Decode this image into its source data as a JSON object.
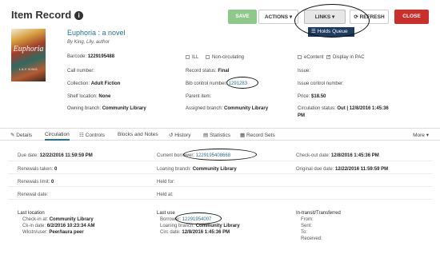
{
  "header": {
    "title": "Item Record",
    "info_glyph": "i",
    "save_label": "SAVE",
    "actions_label": "ACTIONS ▾",
    "links_label": "LINKS ▾",
    "refresh_label": "REFRESH",
    "close_label": "CLOSE",
    "links_menu_item": "Holds Queue",
    "colors": {
      "save": "#8cc98a",
      "close": "#c9302c",
      "link": "#27718f"
    }
  },
  "book": {
    "cover_author": "LILY KING",
    "cover_title": "Euphoria",
    "title": "Euphoria : a novel",
    "author": "By King, Lily, author"
  },
  "details": {
    "barcode_label": "Barcode:",
    "barcode_value": "1229195488",
    "call_number_label": "Call number:",
    "collection_label": "Collection:",
    "collection_value": "Adult Fiction",
    "shelf_label": "Shelf location:",
    "shelf_value": "None",
    "owning_label": "Owning branch:",
    "owning_value": "Community Library",
    "ill_label": "ILL",
    "noncirc_label": "Non-circulating",
    "record_status_label": "Record status:",
    "record_status_value": "Final",
    "bib_label": "Bib control number:",
    "bib_value": "1291283",
    "parent_label": "Parent item:",
    "assigned_label": "Assigned branch:",
    "assigned_value": "Community Library",
    "econtent_label": "eContent",
    "pac_label": "Display in PAC",
    "issue_label": "Issue:",
    "issue_control_label": "Issue control number:",
    "price_label": "Price:",
    "price_value": "$18.50",
    "circ_status_label": "Circulation status:",
    "circ_status_value": "Out | 12/8/2016 1:45:36",
    "circ_status_value2": "PM"
  },
  "tabs": {
    "details": "Details",
    "circulation": "Circulation",
    "controls": "Controls",
    "blocks": "Blocks and Notes",
    "history": "History",
    "statistics": "Statistics",
    "record_sets": "Record Sets",
    "more": "More ▾"
  },
  "circ": {
    "due_date_label": "Due date:",
    "due_date_value": "12/22/2016 11:59:59 PM",
    "renewals_taken_label": "Renewals taken:",
    "renewals_taken_value": "0",
    "renewals_limit_label": "Renewals limit:",
    "renewals_limit_value": "0",
    "renewal_date_label": "Renewal date:",
    "current_borrower_label": "Current borrower:",
    "current_borrower_value": "1229195408668",
    "loaning_label": "Loaning branch:",
    "loaning_value": "Community Library",
    "held_for_label": "Held for:",
    "held_at_label": "Held at:",
    "checkout_label": "Check-out date:",
    "checkout_value": "12/8/2016 1:45:36 PM",
    "original_due_label": "Original due date:",
    "original_due_value": "12/22/2016 11:59:59 PM"
  },
  "last_location": {
    "heading": "Last location",
    "checkin_label": "Check-in at:",
    "checkin_value": "Community Library",
    "ckin_date_label": "Ck-in date:",
    "ckin_date_value": "6/2/2016 10:23:34 AM",
    "wks_label": "Wkstn/user:",
    "wks_value": "Peer/laura peer"
  },
  "last_use": {
    "heading": "Last use",
    "borrower_label": "Borrower:",
    "borrower_value": "12291954007",
    "loaning_label": "Loaning branch:",
    "loaning_value": "Community Library",
    "circ_date_label": "Circ date:",
    "circ_date_value": "12/8/2016 1:45:36 PM"
  },
  "transit": {
    "heading": "In-transit/Transferred",
    "from": "From:",
    "sent": "Sent:",
    "to": "To:",
    "received": "Received:"
  }
}
